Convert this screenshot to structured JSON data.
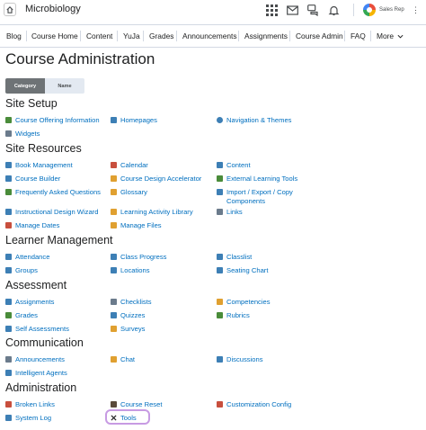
{
  "header": {
    "course_name": "Microbiology",
    "user_name": "Sales Rep",
    "more_glyph": "⋮"
  },
  "nav": {
    "items": [
      "Blog",
      "Course Home",
      "Content",
      "YuJa",
      "Grades",
      "Announcements",
      "Assignments",
      "Course Admin",
      "FAQ",
      "More"
    ],
    "more_icon": "chevron-down-icon"
  },
  "page": {
    "title": "Course Administration",
    "toggle": {
      "category": "Category",
      "name": "Name",
      "selected": "Category"
    }
  },
  "sections": [
    {
      "title": "Site Setup",
      "tools": [
        {
          "label": "Course Offering Information",
          "icon": "info-icon",
          "color": "#4a8c3a"
        },
        {
          "label": "Homepages",
          "icon": "homepage-icon",
          "color": "#3d7fb5"
        },
        {
          "label": "Navigation & Themes",
          "icon": "compass-icon",
          "color": "#3d7fb5"
        },
        {
          "label": "Widgets",
          "icon": "widget-icon",
          "color": "#6b7b8c"
        }
      ]
    },
    {
      "title": "Site Resources",
      "tools": [
        {
          "label": "Book Management",
          "icon": "book-icon",
          "color": "#3d7fb5"
        },
        {
          "label": "Calendar",
          "icon": "calendar-icon",
          "color": "#c84f3d"
        },
        {
          "label": "Content",
          "icon": "content-icon",
          "color": "#3d7fb5"
        },
        {
          "label": "Course Builder",
          "icon": "builder-icon",
          "color": "#3d7fb5"
        },
        {
          "label": "Course Design Accelerator",
          "icon": "accelerator-icon",
          "color": "#e0a030"
        },
        {
          "label": "External Learning Tools",
          "icon": "external-tools-icon",
          "color": "#4a8c3a"
        },
        {
          "label": "Frequently Asked Questions",
          "icon": "faq-icon",
          "color": "#4a8c3a"
        },
        {
          "label": "Glossary",
          "icon": "glossary-icon",
          "color": "#e0a030"
        },
        {
          "label": "Import / Export / Copy Components",
          "icon": "import-export-icon",
          "color": "#3d7fb5"
        },
        {
          "label": "Instructional Design Wizard",
          "icon": "wizard-icon",
          "color": "#3d7fb5"
        },
        {
          "label": "Learning Activity Library",
          "icon": "library-icon",
          "color": "#e0a030"
        },
        {
          "label": "Links",
          "icon": "link-icon",
          "color": "#6b7b8c"
        },
        {
          "label": "Manage Dates",
          "icon": "dates-icon",
          "color": "#c84f3d"
        },
        {
          "label": "Manage Files",
          "icon": "folder-icon",
          "color": "#e0a030"
        }
      ]
    },
    {
      "title": "Learner Management",
      "tools": [
        {
          "label": "Attendance",
          "icon": "attendance-icon",
          "color": "#3d7fb5"
        },
        {
          "label": "Class Progress",
          "icon": "progress-icon",
          "color": "#3d7fb5"
        },
        {
          "label": "Classlist",
          "icon": "classlist-icon",
          "color": "#3d7fb5"
        },
        {
          "label": "Groups",
          "icon": "groups-icon",
          "color": "#3d7fb5"
        },
        {
          "label": "Locations",
          "icon": "location-icon",
          "color": "#3d7fb5"
        },
        {
          "label": "Seating Chart",
          "icon": "seating-icon",
          "color": "#3d7fb5"
        }
      ]
    },
    {
      "title": "Assessment",
      "tools": [
        {
          "label": "Assignments",
          "icon": "assignments-icon",
          "color": "#3d7fb5"
        },
        {
          "label": "Checklists",
          "icon": "checklist-icon",
          "color": "#6b7b8c"
        },
        {
          "label": "Competencies",
          "icon": "competencies-icon",
          "color": "#e0a030"
        },
        {
          "label": "Grades",
          "icon": "grades-icon",
          "color": "#4a8c3a"
        },
        {
          "label": "Quizzes",
          "icon": "quiz-icon",
          "color": "#3d7fb5"
        },
        {
          "label": "Rubrics",
          "icon": "rubrics-icon",
          "color": "#4a8c3a"
        },
        {
          "label": "Self Assessments",
          "icon": "self-assessment-icon",
          "color": "#3d7fb5"
        },
        {
          "label": "Surveys",
          "icon": "survey-icon",
          "color": "#e0a030"
        }
      ]
    },
    {
      "title": "Communication",
      "tools": [
        {
          "label": "Announcements",
          "icon": "announcement-icon",
          "color": "#6b7b8c"
        },
        {
          "label": "Chat",
          "icon": "chat-icon",
          "color": "#e0a030"
        },
        {
          "label": "Discussions",
          "icon": "discussion-icon",
          "color": "#3d7fb5"
        },
        {
          "label": "Intelligent Agents",
          "icon": "agent-icon",
          "color": "#3d7fb5"
        }
      ]
    },
    {
      "title": "Administration",
      "tools": [
        {
          "label": "Broken Links",
          "icon": "broken-link-icon",
          "color": "#c84f3d"
        },
        {
          "label": "Course Reset",
          "icon": "reset-icon",
          "color": "#5a4a3a"
        },
        {
          "label": "Customization Config",
          "icon": "customization-icon",
          "color": "#c84f3d"
        },
        {
          "label": "System Log",
          "icon": "log-icon",
          "color": "#3d7fb5"
        },
        {
          "label": "Tools",
          "icon": "tools-icon",
          "color": "#202122"
        }
      ]
    }
  ],
  "colors": {
    "link": "#006fbf",
    "highlight_outline": "#c79be3",
    "toggle_active": "#6e7376"
  }
}
